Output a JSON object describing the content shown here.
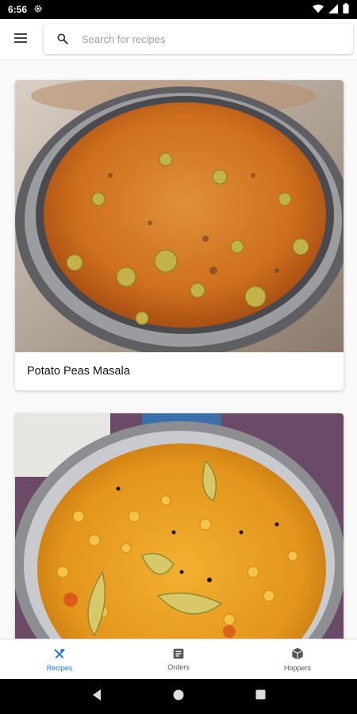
{
  "status_bar": {
    "time": "6:56"
  },
  "header": {
    "search_placeholder": "Search for recipes"
  },
  "recipes": [
    {
      "title": "Potato Peas Masala"
    },
    {
      "title": ""
    }
  ],
  "bottom_nav": [
    {
      "label": "Recipes",
      "icon": "utensils-icon",
      "active": true
    },
    {
      "label": "Orders",
      "icon": "receipt-icon",
      "active": false
    },
    {
      "label": "Hoppers",
      "icon": "box-icon",
      "active": false
    }
  ],
  "colors": {
    "accent": "#1a73e8",
    "status_bar": "#000000"
  }
}
